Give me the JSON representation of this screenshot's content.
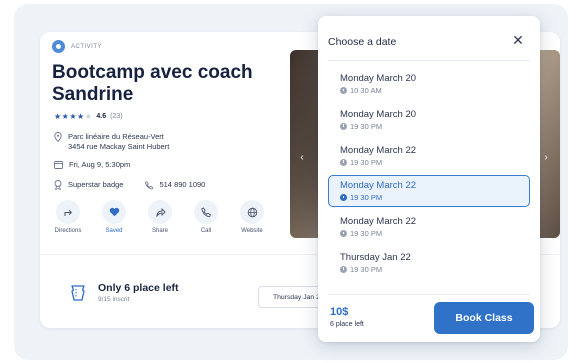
{
  "colors": {
    "accent": "#2f72c8",
    "selected_bg": "#eaf2fb",
    "title": "#16223f",
    "backdrop": "#eef3f8"
  },
  "activity": {
    "category": "Activity",
    "title": "Bootcamp avec coach Sandrine",
    "rating": {
      "stars_filled": 4,
      "stars_total": 5,
      "score": "4.6",
      "count": "(23)"
    },
    "address_line1": "Parc linéaire du Réseau-Vert",
    "address_line2": "3454 rue Mackay Saint Hubert",
    "datetime": "Fri, Aug 9, 5:30pm",
    "badge": "Superstar badge",
    "phone": "514 890 1090",
    "actions": [
      {
        "label": "Directions",
        "icon": "directions-icon"
      },
      {
        "label": "Saved",
        "icon": "heart-icon"
      },
      {
        "label": "Share",
        "icon": "share-icon"
      },
      {
        "label": "Call",
        "icon": "phone-icon"
      },
      {
        "label": "Website",
        "icon": "globe-icon"
      }
    ],
    "places_title": "Only 6 place left",
    "places_sub": "9/15 inscrit",
    "selected_date": "Thursday Jan 22 · 20"
  },
  "picker": {
    "title": "Choose a date",
    "close_icon": "close-icon",
    "slots": [
      {
        "day": "Monday  March 20",
        "time": "10 30 AM",
        "selected": false
      },
      {
        "day": "Monday  March 20",
        "time": "19 30 PM",
        "selected": false
      },
      {
        "day": "Monday  March 22",
        "time": "19 30 PM",
        "selected": false
      },
      {
        "day": "Monday  March 22",
        "time": "19 30 PM",
        "selected": true
      },
      {
        "day": "Monday  March 22",
        "time": "19 30 PM",
        "selected": false
      },
      {
        "day": "Thursday Jan 22",
        "time": "19 30 PM",
        "selected": false
      }
    ],
    "price": "10$",
    "price_sub": "6 place left",
    "book_label": "Book Class"
  }
}
